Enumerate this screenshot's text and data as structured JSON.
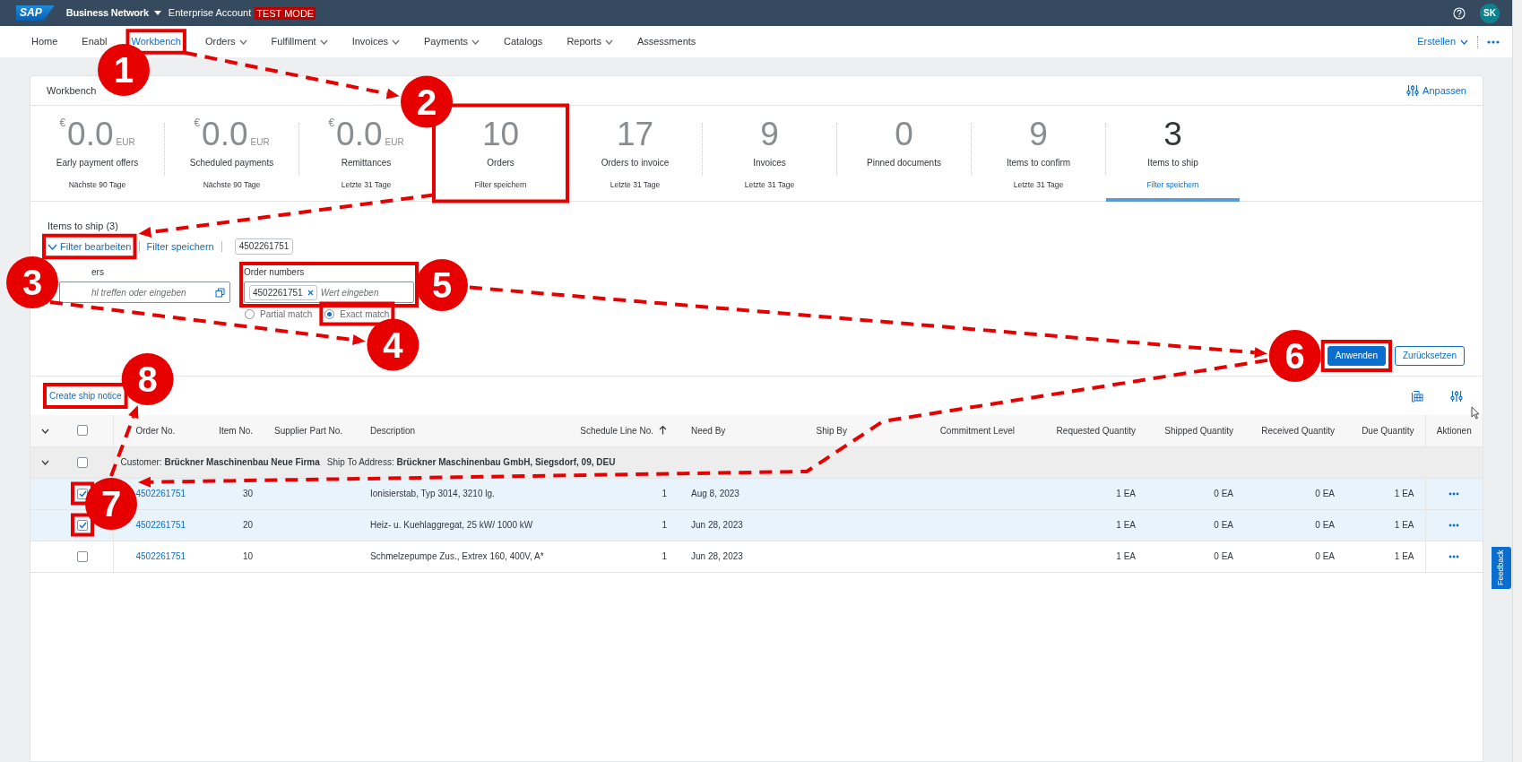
{
  "top_bar": {
    "logo": "SAP",
    "product": "Business Network",
    "account": "Enterprise Account",
    "mode_badge": "TEST MODE",
    "avatar": "SK"
  },
  "nav": {
    "items": [
      {
        "label": "Home",
        "selected": false,
        "dropdown": false
      },
      {
        "label": "Enabl",
        "selected": false,
        "dropdown": false
      },
      {
        "label": "Workbench",
        "selected": true,
        "dropdown": false
      },
      {
        "label": "Orders",
        "selected": false,
        "dropdown": true
      },
      {
        "label": "Fulfillment",
        "selected": false,
        "dropdown": true
      },
      {
        "label": "Invoices",
        "selected": false,
        "dropdown": true
      },
      {
        "label": "Payments",
        "selected": false,
        "dropdown": true
      },
      {
        "label": "Catalogs",
        "selected": false,
        "dropdown": false
      },
      {
        "label": "Reports",
        "selected": false,
        "dropdown": true
      },
      {
        "label": "Assessments",
        "selected": false,
        "dropdown": false
      }
    ],
    "create_menu": "Erstellen"
  },
  "workbench": {
    "title": "Workbench",
    "customize": "Anpassen",
    "tiles": [
      {
        "kind": "amount",
        "currency": "€",
        "value": "0.0",
        "unit": "EUR",
        "label": "Early payment offers",
        "period": "Nächste 90 Tage",
        "selected": false
      },
      {
        "kind": "amount",
        "currency": "€",
        "value": "0.0",
        "unit": "EUR",
        "label": "Scheduled payments",
        "period": "Nächste 90 Tage",
        "selected": false
      },
      {
        "kind": "amount",
        "currency": "€",
        "value": "0.0",
        "unit": "EUR",
        "label": "Remittances",
        "period": "Letzte 31 Tage",
        "selected": false
      },
      {
        "kind": "count",
        "value": "10",
        "label": "Orders",
        "period": "Filter speichern",
        "selected": false
      },
      {
        "kind": "count",
        "value": "17",
        "label": "Orders to invoice",
        "period": "Letzte 31 Tage",
        "selected": false
      },
      {
        "kind": "count",
        "value": "9",
        "label": "Invoices",
        "period": "Letzte 31 Tage",
        "selected": false
      },
      {
        "kind": "count",
        "value": "0",
        "label": "Pinned documents",
        "selected": false
      },
      {
        "kind": "count",
        "value": "9",
        "label": "Items to confirm",
        "period": "Letzte 31 Tage",
        "selected": false
      },
      {
        "kind": "count",
        "value": "3",
        "label": "Items to ship",
        "period": "Filter speichern",
        "selected": true
      }
    ]
  },
  "filter": {
    "heading": "Items to ship (3)",
    "edit_link": "Filter bearbeiten",
    "save_link": "Filter speichern",
    "chip": "4502261751",
    "fields": [
      {
        "kind": "select",
        "label": "ers",
        "placeholder": "hl treffen oder eingeben"
      },
      {
        "kind": "tokens",
        "label": "Order numbers",
        "tokens": [
          "4502261751"
        ],
        "placeholder": "Wert eingeben"
      }
    ],
    "match": [
      {
        "label": "Partial match",
        "selected": false
      },
      {
        "label": "Exact match",
        "selected": true
      }
    ],
    "buttons": [
      {
        "label": "Anwenden",
        "kind": "primary"
      },
      {
        "label": "Zurücksetzen",
        "kind": "secondary"
      }
    ]
  },
  "table": {
    "toolbar_link": "Create ship notice",
    "select_all_checked": false,
    "columns": [
      {
        "label": "Order No.",
        "sorted": false
      },
      {
        "label": "Item No.",
        "sorted": false
      },
      {
        "label": "Supplier Part No.",
        "sorted": false
      },
      {
        "label": "Description",
        "sorted": false
      },
      {
        "label": "Schedule Line No.",
        "sorted": true
      },
      {
        "label": "Need By",
        "sorted": false
      },
      {
        "label": "Ship By",
        "sorted": false
      },
      {
        "label": "Commitment Level",
        "sorted": false
      },
      {
        "label": "Requested Quantity",
        "sorted": false
      },
      {
        "label": "Shipped Quantity",
        "sorted": false
      },
      {
        "label": "Received Quantity",
        "sorted": false
      },
      {
        "label": "Due Quantity",
        "sorted": false
      },
      {
        "label": "Aktionen",
        "sorted": false
      }
    ],
    "group": {
      "expanded": true,
      "checked": false,
      "customer": "Customer: **Brückner Maschinenbau Neue Firma**",
      "ship_to": "Ship To Address: **Brückner Maschinenbau GmbH, Siegsdorf, 09, DEU**"
    },
    "rows": [
      {
        "selected": true,
        "order_no": "4502261751",
        "item_no": "30",
        "description": "Ionisierstab, Typ 3014, 3210 lg.",
        "schedule_line": "1",
        "need_by": "Aug 8, 2023",
        "requested_qty": "1 EA",
        "shipped_qty": "0 EA",
        "received_qty": "0 EA",
        "due_qty": "1 EA"
      },
      {
        "selected": true,
        "order_no": "4502261751",
        "item_no": "20",
        "description": "Heiz- u. Kuehlaggregat, 25 kW/ 1000 kW",
        "schedule_line": "1",
        "need_by": "Jun 28, 2023",
        "requested_qty": "1 EA",
        "shipped_qty": "0 EA",
        "received_qty": "0 EA",
        "due_qty": "1 EA"
      },
      {
        "selected": false,
        "order_no": "4502261751",
        "item_no": "10",
        "description": "Schmelzepumpe Zus., Extrex 160, 400V, A*",
        "schedule_line": "1",
        "need_by": "Jun 28, 2023",
        "requested_qty": "1 EA",
        "shipped_qty": "0 EA",
        "received_qty": "0 EA",
        "due_qty": "1 EA"
      }
    ]
  },
  "feedback": "Feedback",
  "annotations": [
    {
      "number": "1"
    },
    {
      "number": "2"
    },
    {
      "number": "3"
    },
    {
      "number": "4"
    },
    {
      "number": "5"
    },
    {
      "number": "6"
    },
    {
      "number": "7"
    },
    {
      "number": "8"
    }
  ]
}
